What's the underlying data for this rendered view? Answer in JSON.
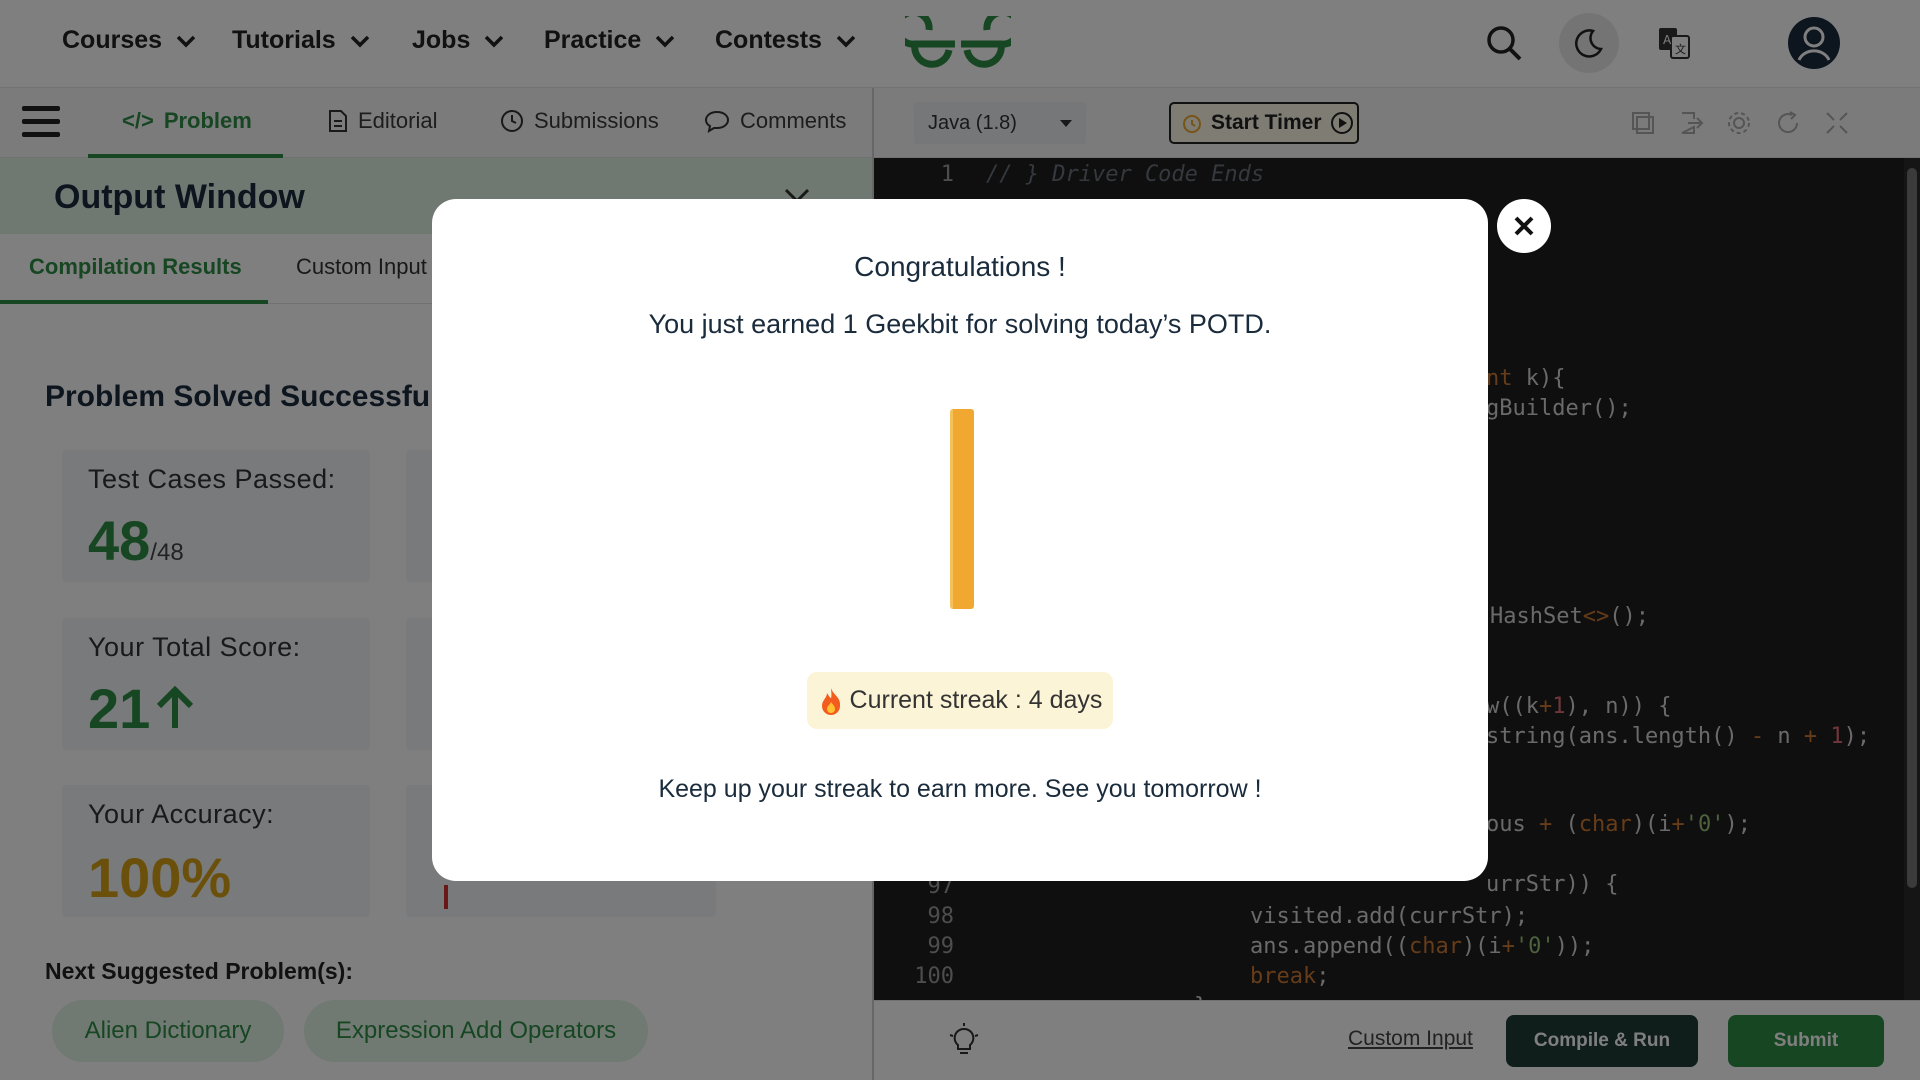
{
  "nav": {
    "items": [
      {
        "label": "Courses"
      },
      {
        "label": "Tutorials"
      },
      {
        "label": "Jobs"
      },
      {
        "label": "Practice"
      },
      {
        "label": "Contests"
      }
    ],
    "icons": [
      "search-icon",
      "moon-icon",
      "translate-icon",
      "user-avatar-icon"
    ]
  },
  "problem_tabs": {
    "items": [
      {
        "label": "Problem"
      },
      {
        "label": "Editorial"
      },
      {
        "label": "Submissions"
      },
      {
        "label": "Comments"
      }
    ],
    "active": "Problem"
  },
  "output_window": {
    "title": "Output Window",
    "tabs": [
      {
        "label": "Compilation Results"
      },
      {
        "label": "Custom Input"
      }
    ],
    "status": "Problem Solved Successfully",
    "test_cases": {
      "label": "Test Cases Passed:",
      "value": "48",
      "total": "/48"
    },
    "score": {
      "label": "Your Total Score:",
      "value": "21"
    },
    "accuracy": {
      "label": "Your Accuracy:",
      "value": "100%"
    },
    "next_label": "Next Suggested Problem(s):",
    "suggestions": [
      {
        "label": "Alien Dictionary"
      },
      {
        "label": "Expression Add Operators"
      }
    ]
  },
  "editor": {
    "language": "Java (1.8)",
    "timer_label": "Start Timer",
    "custom_input_label": "Custom Input",
    "compile_label": "Compile & Run",
    "submit_label": "Submit",
    "line_numbers": [
      "1",
      "97",
      "98",
      "99",
      "100"
    ]
  },
  "modal": {
    "title": "Congratulations !",
    "message": "You just earned 1 Geekbit for solving today’s POTD.",
    "streak": "Current streak : 4 days",
    "footer": "Keep up your streak to earn more. See you tomorrow !"
  },
  "colors": {
    "brand_green": "#2f8d46",
    "dark_button": "#1e3a36",
    "accent_orange": "#f0a830",
    "accuracy_color": "#d4a017"
  }
}
